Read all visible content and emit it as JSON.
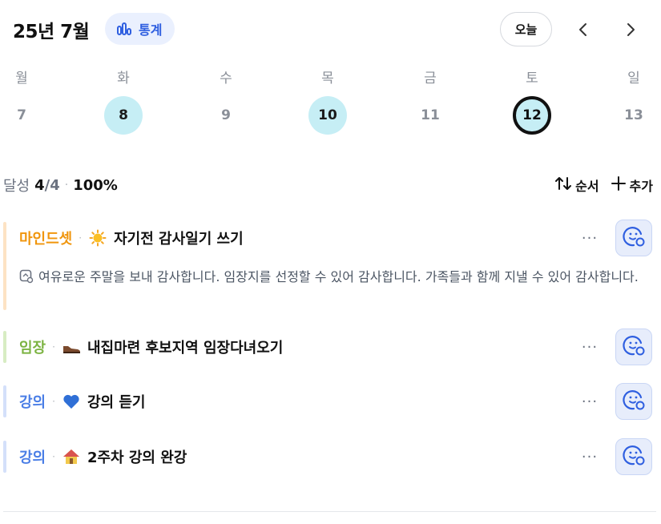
{
  "header": {
    "month_label": "25년 7월",
    "stats_label": "통계",
    "today_label": "오늘",
    "prev_icon": "chevron-left-icon",
    "next_icon": "chevron-right-icon"
  },
  "week": {
    "days": [
      {
        "name": "월",
        "date": "7",
        "state": "none"
      },
      {
        "name": "화",
        "date": "8",
        "state": "done"
      },
      {
        "name": "수",
        "date": "9",
        "state": "none"
      },
      {
        "name": "목",
        "date": "10",
        "state": "done"
      },
      {
        "name": "금",
        "date": "11",
        "state": "none"
      },
      {
        "name": "토",
        "date": "12",
        "state": "selected"
      },
      {
        "name": "일",
        "date": "13",
        "state": "none"
      }
    ]
  },
  "summary": {
    "label": "달성",
    "done": "4",
    "total": "/4",
    "separator": "·",
    "percent": "100%"
  },
  "actions": {
    "order_label": "순서",
    "add_label": "추가"
  },
  "tasks": [
    {
      "category": "마인드셋",
      "category_color": "#f0950c",
      "bar_color": "#fde3c4",
      "separator": "·",
      "emoji": "sun-icon",
      "title": "자기전 감사일기 쓰기",
      "more_label": "···",
      "note": "여유로운 주말을 보내 감사합니다. 임장지를 선정할 수 있어 감사합니다. 가족들과 함께 지낼 수 있어 감사합니다."
    },
    {
      "category": "임장",
      "category_color": "#7cb342",
      "bar_color": "#d7ecc3",
      "separator": "·",
      "emoji": "shoe-icon",
      "title": "내집마련 후보지역 임장다녀오기",
      "more_label": "···"
    },
    {
      "category": "강의",
      "category_color": "#4a7ee6",
      "bar_color": "#d4e0fa",
      "separator": "·",
      "emoji": "blue-heart-icon",
      "title": "강의 듣기",
      "more_label": "···"
    },
    {
      "category": "강의",
      "category_color": "#4a7ee6",
      "bar_color": "#d4e0fa",
      "separator": "·",
      "emoji": "house-icon",
      "title": "2주차 강의 완강",
      "more_label": "···"
    }
  ],
  "colors": {
    "accent_blue": "#2f5fe0",
    "done_bg": "#c6eef5",
    "done_button_bg": "#e7edfb"
  }
}
